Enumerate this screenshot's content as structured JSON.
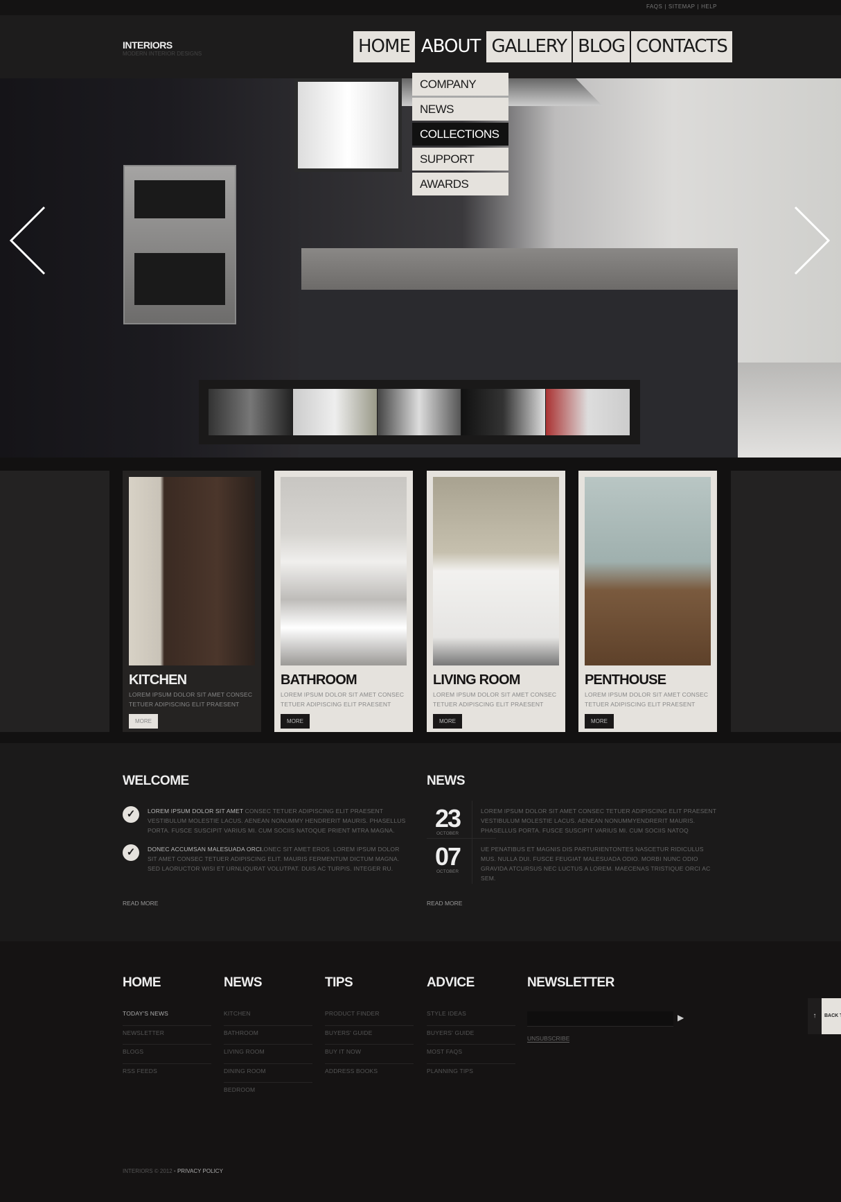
{
  "top_links": [
    "FAQS",
    "SITEMAP",
    "HELP"
  ],
  "logo": {
    "title": "INTERIORS",
    "tagline": "MODERN INTERIOR DESIGNS"
  },
  "nav": {
    "items": [
      "HOME",
      "ABOUT",
      "GALLERY",
      "BLOG",
      "CONTACTS"
    ],
    "active": "ABOUT"
  },
  "dropdown": {
    "items": [
      "COMPANY",
      "NEWS",
      "COLLECTIONS",
      "SUPPORT",
      "AWARDS"
    ],
    "active": "COLLECTIONS"
  },
  "slider": {
    "prev_icon": "chevron-left-icon",
    "next_icon": "chevron-right-icon",
    "thumbnail_count": 5
  },
  "cards": [
    {
      "title": "KITCHEN",
      "text": "LOREM IPSUM DOLOR SIT AMET CONSEC TETUER ADIPISCING ELIT PRAESENT",
      "button": "MORE"
    },
    {
      "title": "BATHROOM",
      "text": "LOREM IPSUM DOLOR SIT AMET CONSEC TETUER ADIPISCING ELIT PRAESENT",
      "button": "MORE"
    },
    {
      "title": "LIVING ROOM",
      "text": "LOREM IPSUM DOLOR SIT AMET CONSEC TETUER ADIPISCING ELIT PRAESENT",
      "button": "MORE"
    },
    {
      "title": "PENTHOUSE",
      "text": "LOREM IPSUM DOLOR SIT AMET CONSEC TETUER ADIPISCING ELIT PRAESENT",
      "button": "MORE"
    }
  ],
  "welcome": {
    "title": "WELCOME",
    "items": [
      {
        "lead": "LOREM IPSUM DOLOR SIT AMET",
        "text": " CONSEC TETUER ADIPISCING ELIT PRAESENT VESTIBULUM MOLESTIE LACUS. AENEAN NONUMMY HENDRERIT MAURIS. PHASELLUS PORTA. FUSCE SUSCIPIT VARIUS MI. CUM SOCIIS NATOQUE PRIENT MTRA MAGNA."
      },
      {
        "lead": "DONEC ACCUMSAN MALESUADA ORCI.",
        "text": "ONEC SIT AMET EROS. LOREM IPSUM DOLOR SIT AMET CONSEC TETUER ADIPISCING ELIT. MAURIS FERMENTUM DICTUM MAGNA. SED LAORUCTOR WISI ET URNLIQURAT VOLUTPAT. DUIS AC TURPIS. INTEGER RU."
      }
    ],
    "read_more": "READ MORE"
  },
  "news": {
    "title": "NEWS",
    "items": [
      {
        "day": "23",
        "month": "OCTOBER",
        "text": "LOREM IPSUM DOLOR SIT AMET CONSEC TETUER ADIPISCING ELIT PRAESENT VESTIBULUM MOLESTIE LACUS. AENEAN NONUMMYENDRERIT MAURIS. PHASELLUS PORTA. FUSCE SUSCIPIT VARIUS MI. CUM SOCIIS NATOQ"
      },
      {
        "day": "07",
        "month": "OCTOBER",
        "text": "UE PENATIBUS ET MAGNIS DIS PARTURIENTONTES NASCETUR RIDICULUS MUS. NULLA DUI. FUSCE FEUGIAT MALESUADA ODIO. MORBI NUNC ODIO GRAVIDA ATCURSUS NEC LUCTUS A LOREM. MAECENAS TRISTIQUE ORCI AC SEM."
      }
    ],
    "read_more": "READ MORE"
  },
  "footer": {
    "columns": [
      {
        "title": "HOME",
        "links": [
          "TODAY'S NEWS",
          "NEWSLETTER",
          "BLOGS",
          "RSS FEEDS"
        ]
      },
      {
        "title": "NEWS",
        "links": [
          "KITCHEN",
          "BATHROOM",
          "LIVING ROOM",
          "DINING ROOM",
          "BEDROOM"
        ]
      },
      {
        "title": "TIPS",
        "links": [
          "PRODUCT FINDER",
          "BUYERS' GUIDE",
          "BUY IT NOW",
          "ADDRESS BOOKS"
        ]
      },
      {
        "title": "ADVICE",
        "links": [
          "STYLE IDEAS",
          "BUYERS' GUIDE",
          "MOST FAQS",
          "PLANNING TIPS"
        ]
      }
    ],
    "newsletter": {
      "title": "NEWSLETTER",
      "input_value": "",
      "unsubscribe": "UNSUBSCRIBE"
    },
    "back_to_top": "BACK T",
    "copyright": "INTERIORS © 2012 •",
    "privacy": "PRIVACY POLICY"
  }
}
